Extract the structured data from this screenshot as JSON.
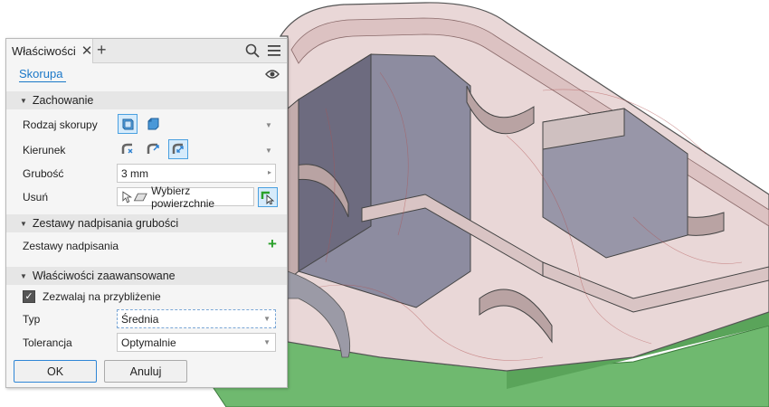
{
  "panel": {
    "tab_title": "Właściwości",
    "close_glyph": "✕",
    "add_glyph": "+",
    "feature_name": "Skorupa"
  },
  "sections": {
    "behavior": "Zachowanie",
    "thickness_overrides": "Zestawy nadpisania grubości",
    "advanced": "Właściwości zaawansowane"
  },
  "fields": {
    "shell_type_label": "Rodzaj skorupy",
    "direction_label": "Kierunek",
    "thickness_label": "Grubość",
    "thickness_value": "3 mm",
    "remove_label": "Usuń",
    "remove_value": "Wybierz powierzchnie",
    "override_sets_label": "Zestawy nadpisania",
    "approximation_label": "Zezwalaj na przybliżenie",
    "approximation_checked": true,
    "type_label": "Typ",
    "type_value": "Średnia",
    "tolerance_label": "Tolerancja",
    "tolerance_value": "Optymalnie"
  },
  "buttons": {
    "ok": "OK",
    "cancel": "Anuluj"
  },
  "colors": {
    "accent": "#1b78c8",
    "add_green": "#2aa02a",
    "model_shell": "#e8d3d3",
    "model_green": "#69b56a"
  },
  "icons": {
    "search": "search-icon",
    "menu": "hamburger-menu-icon",
    "visibility": "eye-icon"
  }
}
